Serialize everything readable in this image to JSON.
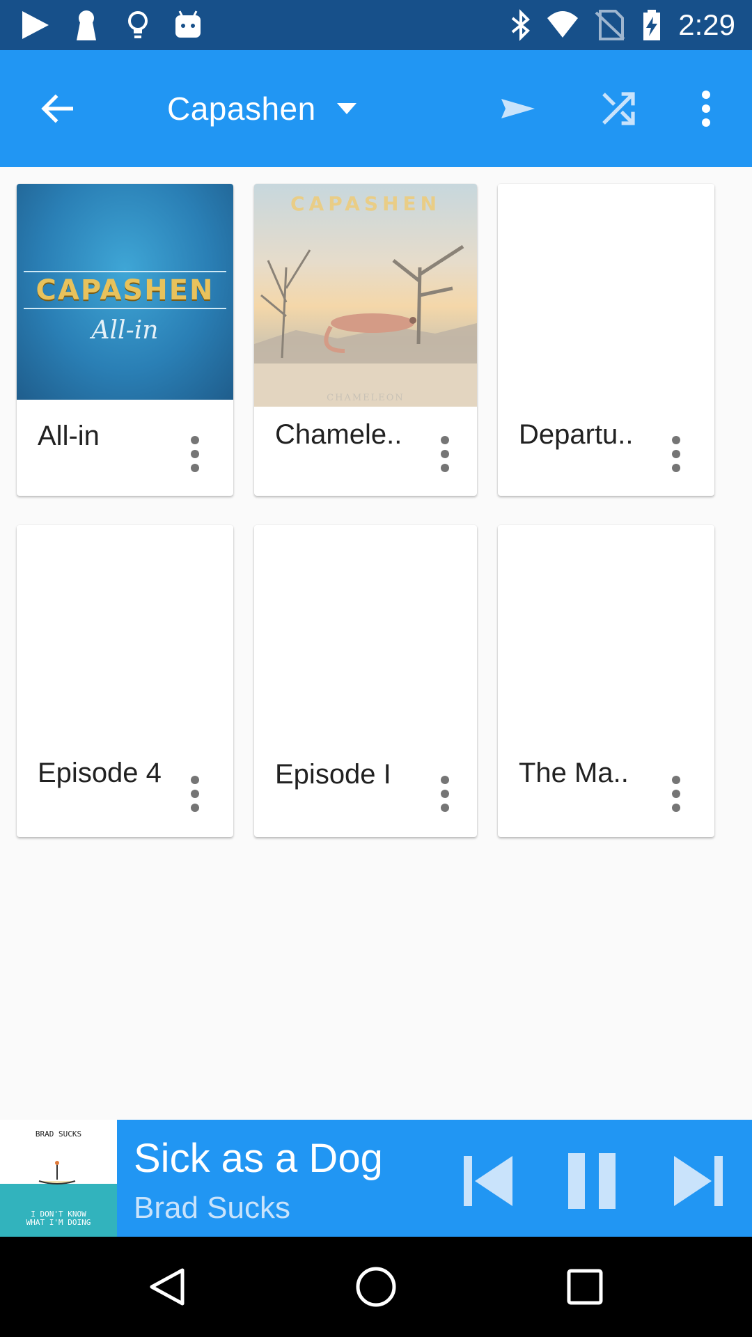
{
  "status_bar": {
    "time": "2:29",
    "icons": [
      "play-store-icon",
      "keyhole-icon",
      "lightbulb-icon",
      "android-icon",
      "bluetooth-icon",
      "wifi-icon",
      "no-sim-icon",
      "battery-charging-icon"
    ]
  },
  "app_bar": {
    "title": "Capashen",
    "back_icon": "arrow-back-icon",
    "dropdown_icon": "arrow-drop-down-icon",
    "actions": [
      "play-icon",
      "shuffle-icon",
      "more-vert-icon"
    ],
    "color": "#2196f3"
  },
  "albums": [
    {
      "label": "All-in",
      "cover_title": "CAPASHEN",
      "cover_subtitle": "All-in"
    },
    {
      "label": "Chamele..",
      "cover_title": "CAPASHEN",
      "cover_subtitle": "CHAMELEON"
    },
    {
      "label": "Departu..",
      "cover_title": "",
      "cover_subtitle": ""
    },
    {
      "label": "Episode 4",
      "cover_title": "",
      "cover_subtitle": ""
    },
    {
      "label": "Episode I",
      "cover_title": "",
      "cover_subtitle": ""
    },
    {
      "label": "The Ma..",
      "cover_title": "",
      "cover_subtitle": ""
    }
  ],
  "now_playing": {
    "title": "Sick as a Dog",
    "artist": "Brad Sucks",
    "art_top_text": "BRAD SUCKS",
    "art_bottom_line1": "I DON'T KNOW",
    "art_bottom_line2": "WHAT I'M DOING",
    "controls": [
      "skip-previous-icon",
      "pause-icon",
      "skip-next-icon"
    ]
  },
  "nav_bar": {
    "buttons": [
      "back-triangle-icon",
      "home-circle-icon",
      "recents-square-icon"
    ]
  }
}
